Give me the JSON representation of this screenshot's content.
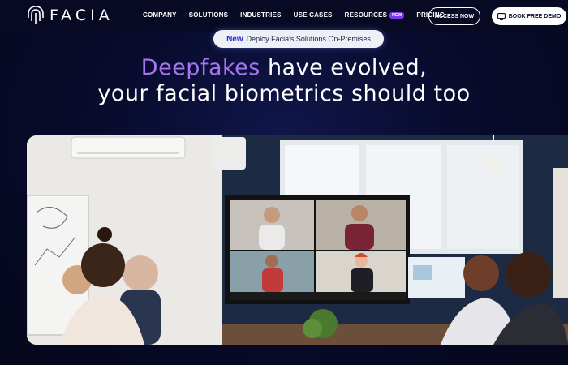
{
  "nav": {
    "logo_text": "FACIA",
    "items": [
      {
        "label": "COMPANY"
      },
      {
        "label": "SOLUTIONS"
      },
      {
        "label": "INDUSTRIES"
      },
      {
        "label": "USE CASES"
      },
      {
        "label": "RESOURCES",
        "badge": "NEW"
      },
      {
        "label": "PRICING"
      }
    ],
    "access_label": "ACCESS NOW",
    "demo_label": "BOOK FREE DEMO"
  },
  "announcement": {
    "tag": "New",
    "text": "Deploy Facia's Solutions On-Premises"
  },
  "hero": {
    "headline_accent": "Deepfakes",
    "headline_rest": " have evolved,",
    "headline_line2": "your facial biometrics should too"
  },
  "colors": {
    "background": "#070a26",
    "accent_purple": "#a675ee",
    "badge_purple": "#7c3aed"
  },
  "icons": [
    "fingerprint-logo-icon",
    "monitor-icon"
  ]
}
